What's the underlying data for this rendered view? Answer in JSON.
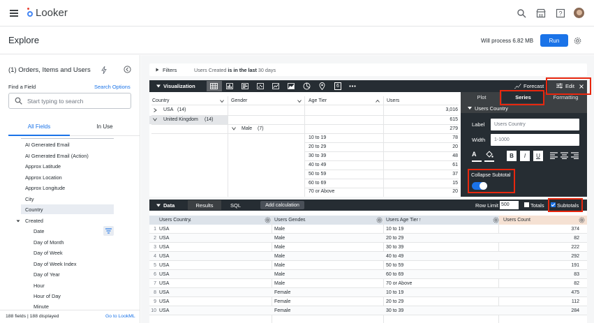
{
  "app": {
    "name": "Looker"
  },
  "page": {
    "title": "Explore",
    "process_text": "Will process 6.82 MB",
    "run_label": "Run"
  },
  "sidebar": {
    "title": "(1) Orders, Items and Users",
    "find_label": "Find a Field",
    "search_options": "Search Options",
    "search_placeholder": "Start typing to search",
    "tab_all": "All Fields",
    "tab_in_use": "In Use",
    "fields": [
      "AI Generated Email",
      "AI Generated Email (Action)",
      "Approx Latitude",
      "Approx Location",
      "Approx Longitude",
      "City",
      "Country"
    ],
    "created_group": "Created",
    "created_fields": [
      "Date",
      "Day of Month",
      "Day of Week",
      "Day of Week Index",
      "Day of Year",
      "Hour",
      "Hour of Day",
      "Minute"
    ],
    "footer_count": "188 fields | 188 displayed",
    "footer_link": "Go to LookML"
  },
  "filters": {
    "label": "Filters",
    "summary_prefix": "Users Created",
    "summary_bold": "is in the last",
    "summary_suffix": "30 days"
  },
  "viz": {
    "label": "Visualization",
    "forecast": "Forecast",
    "edit": "Edit",
    "icon_six": "6",
    "headers": {
      "country": "Country",
      "gender": "Gender",
      "age_tier": "Age Tier",
      "users": "Users"
    },
    "rows": [
      {
        "label": "USA",
        "count": "(14)",
        "users": "3,016"
      },
      {
        "label": "United Kingdom",
        "count": "(14)",
        "users": "615"
      },
      {
        "gender": "Male",
        "gcount": "(7)",
        "users": "279"
      },
      {
        "age": "10 to 19",
        "users": "78"
      },
      {
        "age": "20 to 29",
        "users": "20"
      },
      {
        "age": "30 to 39",
        "users": "48"
      },
      {
        "age": "40 to 49",
        "users": "61"
      },
      {
        "age": "50 to 59",
        "users": "37"
      },
      {
        "age": "60 to 69",
        "users": "15"
      },
      {
        "age": "70 or Above",
        "users": "20"
      }
    ]
  },
  "edit_panel": {
    "tabs": [
      "Plot",
      "Series",
      "Formatting"
    ],
    "section": "Users Country",
    "label_field": "Label",
    "label_value": "Users Country",
    "width_field": "Width",
    "width_value": "1-1000",
    "collapse_subtotal": "Collapse Subtotal",
    "collapse_on": true
  },
  "data": {
    "label": "Data",
    "tab_results": "Results",
    "tab_sql": "SQL",
    "add_calc": "Add calculation",
    "row_limit_label": "Row Limit",
    "row_limit_value": "500",
    "totals": "Totals",
    "subtotals": "Subtotals",
    "columns": [
      "Users Country",
      "Users Gender",
      "Users Age Tier",
      "Users Count"
    ],
    "rows": [
      [
        "1",
        "USA",
        "Male",
        "10 to 19",
        "374"
      ],
      [
        "2",
        "USA",
        "Male",
        "20 to 29",
        "82"
      ],
      [
        "3",
        "USA",
        "Male",
        "30 to 39",
        "222"
      ],
      [
        "4",
        "USA",
        "Male",
        "40 to 49",
        "292"
      ],
      [
        "5",
        "USA",
        "Male",
        "50 to 59",
        "191"
      ],
      [
        "6",
        "USA",
        "Male",
        "60 to 69",
        "83"
      ],
      [
        "7",
        "USA",
        "Male",
        "70 or Above",
        "82"
      ],
      [
        "8",
        "USA",
        "Female",
        "10 to 19",
        "475"
      ],
      [
        "9",
        "USA",
        "Female",
        "20 to 29",
        "112"
      ],
      [
        "10",
        "USA",
        "Female",
        "30 to 39",
        "284"
      ]
    ]
  }
}
